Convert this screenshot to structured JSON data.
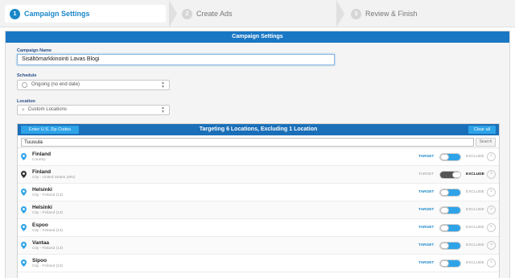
{
  "stepper": {
    "steps": [
      {
        "num": "1",
        "label": "Campaign Settings"
      },
      {
        "num": "2",
        "label": "Create Ads"
      },
      {
        "num": "3",
        "label": "Review & Finish"
      }
    ]
  },
  "panel": {
    "title": "Campaign Settings",
    "campaign_name_label": "Campaign Name",
    "campaign_name_value": "Sisältömarkkinointi Lavas Blogi",
    "schedule_label": "Schedule",
    "schedule_value": "Ongoing (no end date)",
    "location_label": "Location",
    "location_value": "Custom Locations"
  },
  "locations": {
    "enter_zip_label": "Enter U.S. Zip Codes",
    "title": "Targeting 6 Locations, Excluding 1 Location",
    "clear_label": "Clear all",
    "search_value": "Tuusula",
    "search_button": "Search",
    "target_label": "TARGET",
    "exclude_label": "EXCLUDE",
    "remove_icon": "×",
    "colors": {
      "target": "#1a87c8",
      "exclude": "#555555",
      "toggle_on": "#2ea3e8",
      "toggle_excl": "#555555"
    },
    "items": [
      {
        "name": "Finland",
        "sub": "Country",
        "mode": "target"
      },
      {
        "name": "Finland",
        "sub": "City - United States (MN)",
        "mode": "exclude"
      },
      {
        "name": "Helsinki",
        "sub": "City - Finland (13)",
        "mode": "target"
      },
      {
        "name": "Helsinki",
        "sub": "City - Finland (13)",
        "mode": "target"
      },
      {
        "name": "Espoo",
        "sub": "City - Finland (13)",
        "mode": "target"
      },
      {
        "name": "Vantaa",
        "sub": "City - Finland (13)",
        "mode": "target"
      },
      {
        "name": "Sipoo",
        "sub": "City - Finland (13)",
        "mode": "target"
      }
    ]
  }
}
